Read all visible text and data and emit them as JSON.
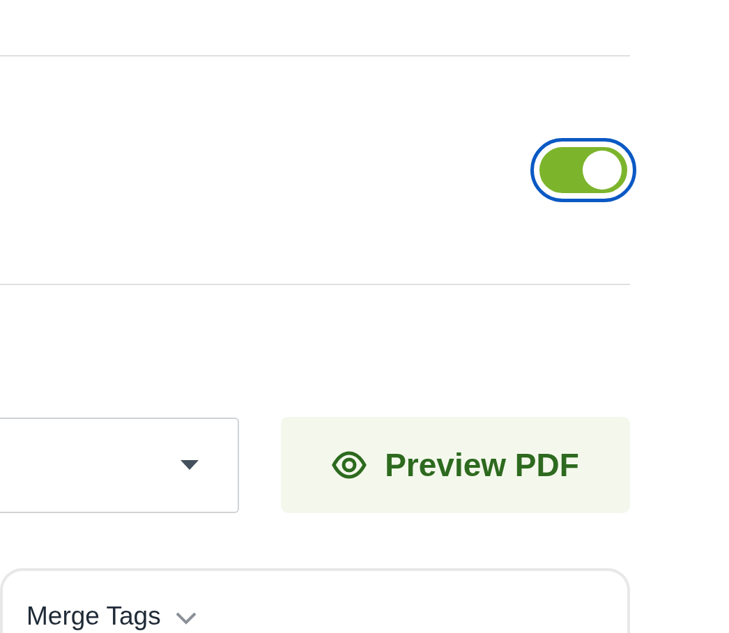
{
  "toggle": {
    "on": true,
    "focused": true
  },
  "preview_button": {
    "label": "Preview PDF"
  },
  "merge_tags": {
    "label": "Merge Tags"
  }
}
